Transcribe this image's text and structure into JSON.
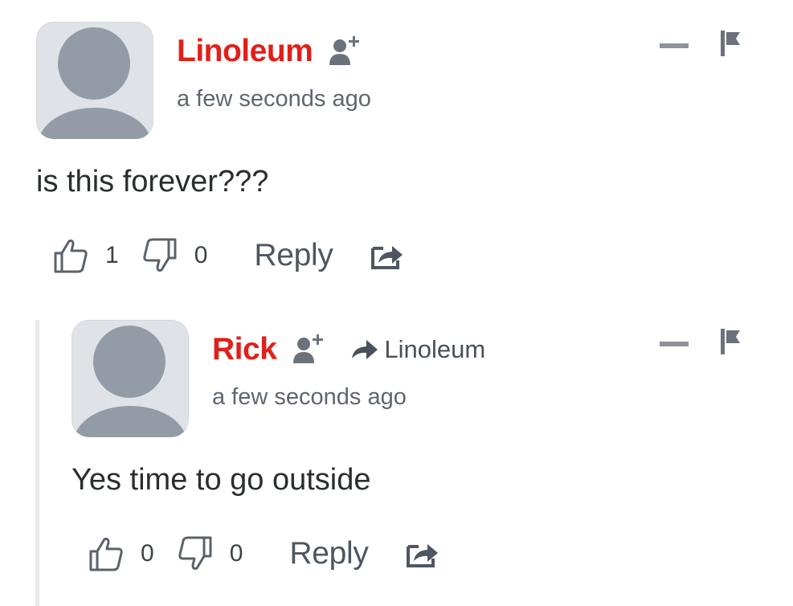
{
  "colors": {
    "author": "#e0201a",
    "text": "#2a2e2e",
    "muted": "#5f6670",
    "icon": "#4e5661",
    "avatar_bg": "#dfe3e7",
    "avatar_fg": "#939ca6",
    "thread_line": "#e7e9ee"
  },
  "icons": {
    "follow": "user-plus-icon",
    "collapse": "minus-icon",
    "flag": "flag-icon",
    "upvote": "thumbs-up-icon",
    "downvote": "thumbs-down-icon",
    "share": "share-icon",
    "reply_arrow": "arrow-right-icon"
  },
  "comments": [
    {
      "author": "Linoleum",
      "time": "a few seconds ago",
      "text": "is this forever???",
      "upvotes": "1",
      "downvotes": "0",
      "reply_label": "Reply"
    },
    {
      "author": "Rick",
      "reply_to": "Linoleum",
      "time": "a few seconds ago",
      "text": "Yes time to go outside",
      "upvotes": "0",
      "downvotes": "0",
      "reply_label": "Reply"
    }
  ]
}
